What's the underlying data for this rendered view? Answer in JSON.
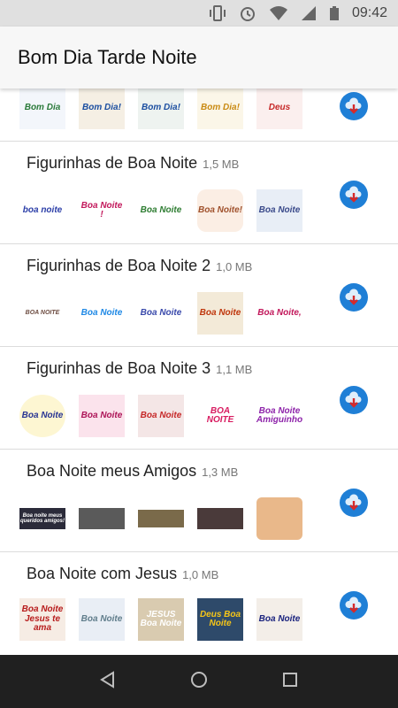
{
  "status": {
    "time": "09:42"
  },
  "app": {
    "title": "Bom Dia Tarde Noite"
  },
  "packs": [
    {
      "name": "",
      "size": "",
      "stickers": [
        "Bom Dia",
        "Bom Dia!",
        "Bom Dia!",
        "Bom Dia!",
        "Deus"
      ]
    },
    {
      "name": "Figurinhas de Boa Noite",
      "size": "1,5 MB",
      "stickers": [
        "boa noite",
        "Boa Noite !",
        "Boa Noite",
        "Boa Noite!",
        "Boa Noite"
      ]
    },
    {
      "name": "Figurinhas de Boa Noite 2",
      "size": "1,0 MB",
      "stickers": [
        "BOA NOITE",
        "Boa Noite",
        "Boa Noite",
        "Boa Noite",
        "Boa Noite,"
      ]
    },
    {
      "name": "Figurinhas de Boa Noite 3",
      "size": "1,1 MB",
      "stickers": [
        "Boa Noite",
        "Boa Noite",
        "Boa Noite",
        "BOA NOITE",
        "Boa Noite Amiguinho"
      ]
    },
    {
      "name": "Boa Noite meus Amigos",
      "size": "1,3 MB",
      "stickers": [
        "Boa noite meus queridos amigos!",
        "",
        "",
        "",
        ""
      ]
    },
    {
      "name": "Boa Noite com Jesus",
      "size": "1,0 MB",
      "stickers": [
        "Boa Noite Jesus te ama",
        "Boa Noite",
        "JESUS Boa Noite",
        "Deus Boa Noite",
        "Boa Noite"
      ]
    }
  ],
  "colors": {
    "accent": "#1f7fd6",
    "navbar": "#202020",
    "statusbar": "#e0e0e0"
  }
}
